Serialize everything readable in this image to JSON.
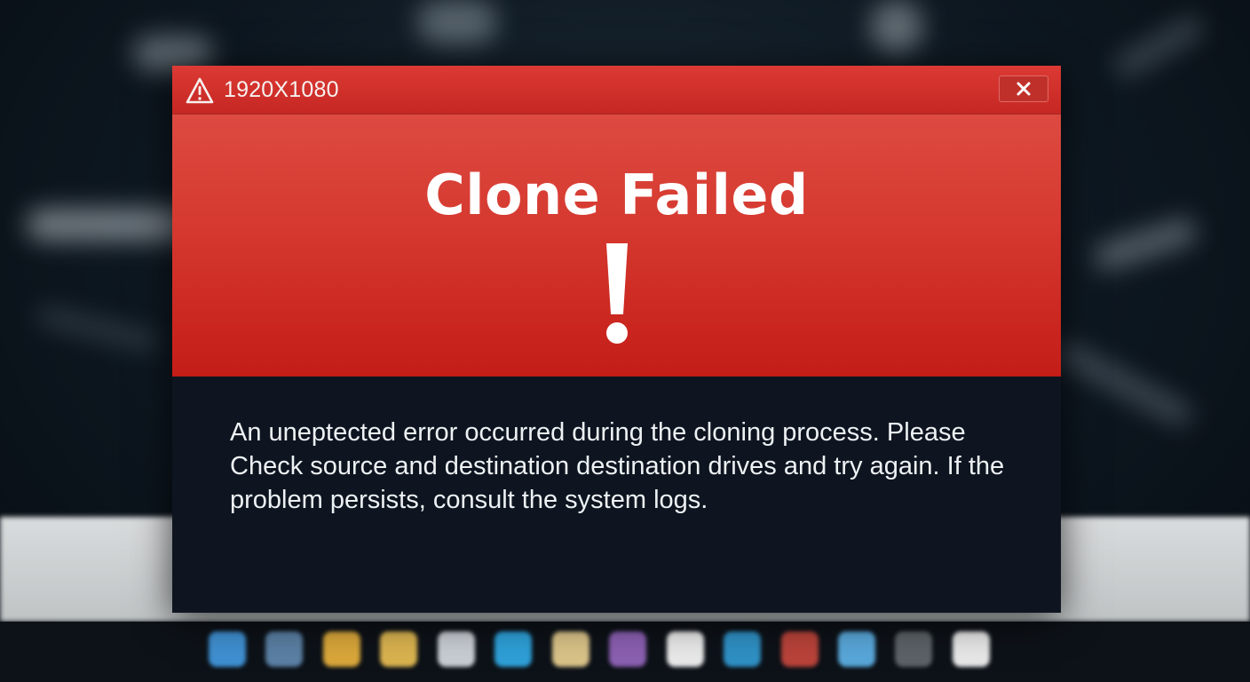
{
  "dialog": {
    "title": "1920X1080",
    "heading": "Clone Failed",
    "message": "An uneptected error occurred during the cloning process. Please Check source and destination destination drives and try again. If the problem persists, consult the system logs.",
    "title_icon": "warning-triangle-icon",
    "hero_icon": "exclamation-icon",
    "close_icon": "close-icon",
    "colors": {
      "titlebar": "#d1302b",
      "hero": "#d63a30",
      "body": "#0e1520",
      "text": "#ffffff"
    }
  },
  "taskbar": {
    "icons": [
      {
        "name": "file-explorer-icon",
        "color": "#3f8fd0"
      },
      {
        "name": "browser-icon",
        "color": "#5a7fa3"
      },
      {
        "name": "chrome-icon",
        "color": "#d8a63a"
      },
      {
        "name": "folder-icon",
        "color": "#d9b24f"
      },
      {
        "name": "window-icon",
        "color": "#c7ccd2"
      },
      {
        "name": "edge-icon",
        "color": "#2e9fd6"
      },
      {
        "name": "notes-icon",
        "color": "#d9c288"
      },
      {
        "name": "app-icon",
        "color": "#8a5fb0"
      },
      {
        "name": "media-icon",
        "color": "#e8e8e8"
      },
      {
        "name": "globe-icon",
        "color": "#2f8fc3"
      },
      {
        "name": "record-icon",
        "color": "#b8433a"
      },
      {
        "name": "store-icon",
        "color": "#58a6d8"
      },
      {
        "name": "camera-icon",
        "color": "#5b6166"
      },
      {
        "name": "document-icon",
        "color": "#e6e6e6"
      }
    ]
  }
}
